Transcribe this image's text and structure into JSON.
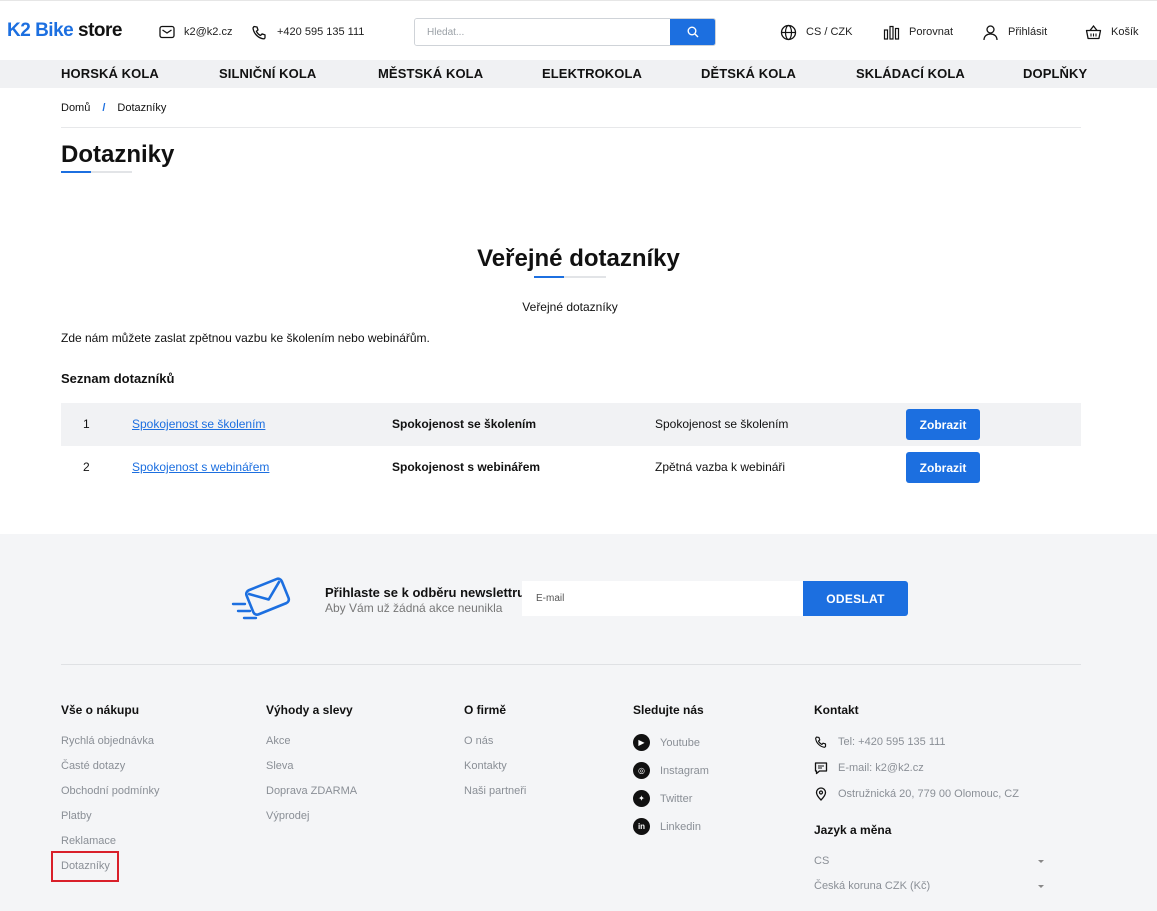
{
  "header": {
    "logo_k2": "K2",
    "logo_bike": "Bike",
    "logo_store": "store",
    "email": "k2@k2.cz",
    "phone": "+420 595 135 111",
    "search_placeholder": "Hledat...",
    "lang_currency": "CS / CZK",
    "compare": "Porovnat",
    "login": "Přihlásit",
    "cart": "Košík"
  },
  "nav": [
    "HORSKÁ KOLA",
    "SILNIČNÍ KOLA",
    "MĚSTSKÁ KOLA",
    "ELEKTROKOLA",
    "DĚTSKÁ KOLA",
    "SKLÁDACÍ KOLA",
    "DOPLŇKY"
  ],
  "breadcrumb": {
    "home": "Domů",
    "sep": "/",
    "current": "Dotazníky"
  },
  "page": {
    "title": "Dotazniky",
    "section_title": "Veřejné dotazníky",
    "section_subtitle": "Veřejné dotazníky",
    "intro": "Zde nám můžete zaslat zpětnou vazbu ke školením nebo webinářům.",
    "list_heading": "Seznam dotazníků"
  },
  "surveys": [
    {
      "num": "1",
      "link": "Spokojenost se školením",
      "name": "Spokojenost se školením",
      "desc": "Spokojenost se školením",
      "button": "Zobrazit"
    },
    {
      "num": "2",
      "link": "Spokojenost s webinářem",
      "name": "Spokojenost s webinářem",
      "desc": "Zpětná vazba k webináři",
      "button": "Zobrazit"
    }
  ],
  "newsletter": {
    "title": "Přihlaste se k odběru newslettru",
    "subtitle": "Aby Vám už žádná akce neunikla",
    "placeholder": "E-mail",
    "button": "ODESLAT"
  },
  "footer": {
    "col1": {
      "heading": "Vše o nákupu",
      "links": [
        "Rychlá objednávka",
        "Časté dotazy",
        "Obchodní podmínky",
        "Platby",
        "Reklamace",
        "Dotazníky"
      ]
    },
    "col2": {
      "heading": "Výhody a slevy",
      "links": [
        "Akce",
        "Sleva",
        "Doprava ZDARMA",
        "Výprodej"
      ]
    },
    "col3": {
      "heading": "O firmě",
      "links": [
        "O nás",
        "Kontakty",
        "Naši partneři"
      ]
    },
    "social": {
      "heading": "Sledujte nás",
      "links": [
        "Youtube",
        "Instagram",
        "Twitter",
        "Linkedin"
      ]
    },
    "contact": {
      "heading": "Kontakt",
      "phone": "Tel: +420 595 135 111",
      "email": "E-mail: k2@k2.cz",
      "address": "Ostružnická 20, 779 00 Olomouc, CZ",
      "lang_heading": "Jazyk a měna",
      "lang_value": "CS",
      "currency_value": "Česká koruna CZK (Kč)"
    }
  },
  "colors": {
    "accent": "#1c6fe0",
    "highlight": "#d9202a"
  }
}
